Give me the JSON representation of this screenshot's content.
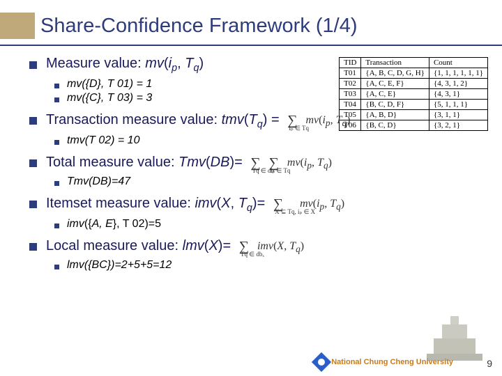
{
  "title": "Share-Confidence Framework (1/4)",
  "bullets": {
    "b1": {
      "prefix": "Measure value: ",
      "fn": "mv",
      "args_ip": "i",
      "args_p": "p",
      "args_Tq_T": "T",
      "args_Tq_q": "q"
    },
    "b1s1": "mv({D}, T 01) = 1",
    "b1s2": "mv({C}, T 03) = 3",
    "b2": {
      "prefix": "Transaction measure value: ",
      "fn": "tmv",
      "arg_T": "T",
      "arg_q": "q",
      "suffix": " = "
    },
    "b2_formula": "Σ mv(iₚ, Tq)",
    "b2_limits": "iₚ ∈ Tq",
    "b2s1": "tmv(T 02) = 10",
    "b3": {
      "prefix": "Total measure value: ",
      "fn": "Tmv",
      "arg": "DB",
      "suffix": "= "
    },
    "b3_formula": "Σ Σ mv(iₚ, Tq)",
    "b3_limits1": "Tq ∈ db",
    "b3_limits2": "iₚ ∈ Tq",
    "b3s1": "Tmv(DB)=47",
    "b4": {
      "prefix": "Itemset measure value: ",
      "fn": "imv",
      "arg1": "X",
      "arg2_T": "T",
      "arg2_q": "q",
      "suffix": "= "
    },
    "b4_formula": "Σ mv(iₚ, Tq)",
    "b4_limits": "X ⊆ Tq, iₚ ∈ X",
    "b4s1": "imv({A, E}, T 02)=5",
    "b5": {
      "prefix": "Local measure value: ",
      "fn": "lmv",
      "arg": "X",
      "suffix": "= "
    },
    "b5_formula": "Σ imv(X, Tq)",
    "b5_limits": "Tq ∈ dbₓ",
    "b5s1": "lmv({BC})=2+5+5=12"
  },
  "table": {
    "headers": [
      "TID",
      "Transaction",
      "Count"
    ],
    "rows": [
      [
        "T01",
        "{A, B, C, D, G, H}",
        "{1, 1, 1, 1, 1, 1}"
      ],
      [
        "T02",
        "{A, C, E, F}",
        "{4, 3, 1, 2}"
      ],
      [
        "T03",
        "{A, C, E}",
        "{4, 3, 1}"
      ],
      [
        "T04",
        "{B, C, D, F}",
        "{5, 1, 1, 1}"
      ],
      [
        "T05",
        "{A, B, D}",
        "{3, 1, 1}"
      ],
      [
        "T06",
        "{B, C, D}",
        "{3, 2, 1}"
      ]
    ]
  },
  "university": "National Chung Cheng University",
  "page": "9"
}
